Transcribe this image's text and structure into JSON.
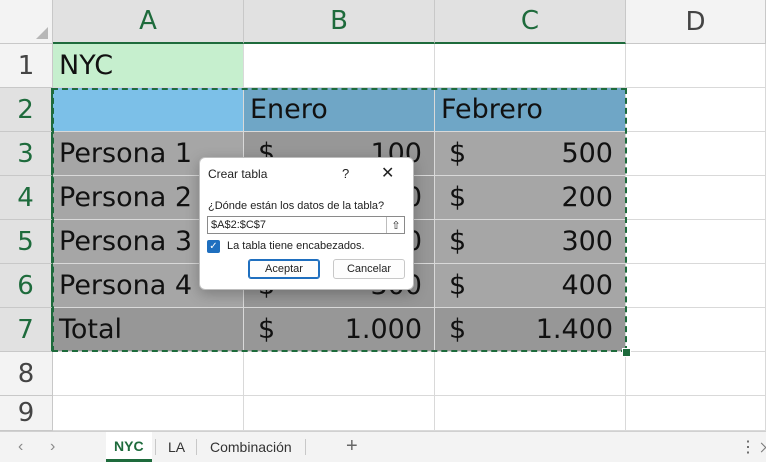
{
  "columns": [
    "A",
    "B",
    "C",
    "D"
  ],
  "rows": [
    "1",
    "2",
    "3",
    "4",
    "5",
    "6",
    "7",
    "8",
    "9"
  ],
  "cells": {
    "a1": "NYC",
    "b2": "Enero",
    "c2": "Febrero",
    "a3": "Persona 1",
    "a4": "Persona 2",
    "a5": "Persona 3",
    "a6": "Persona 4",
    "a7": "Total",
    "currency": "$",
    "b3": "100",
    "b4": "0",
    "b5": "0",
    "b6": "300",
    "b7": "1.000",
    "c3": "500",
    "c4": "200",
    "c5": "300",
    "c6": "400",
    "c7": "1.400"
  },
  "dialog": {
    "title": "Crear tabla",
    "help": "?",
    "close": "✕",
    "question": "¿Dónde están los datos de la tabla?",
    "range_value": "$A$2:$C$7",
    "collapse_icon": "⇧",
    "checkbox_checked": true,
    "checkbox_label": "La tabla tiene encabezados.",
    "ok_label": "Aceptar",
    "cancel_label": "Cancelar"
  },
  "sheet_tabs": {
    "prev": "‹",
    "next": "›",
    "tabs": [
      "NYC",
      "LA",
      "Combinación"
    ],
    "active": "NYC",
    "add": "+",
    "more": "⋮"
  },
  "colors": {
    "accent": "#1e6b3c",
    "header_blue": "#6fa6c6",
    "label_blue": "#7cc0e8",
    "nyc_green": "#c6efce",
    "checkbox_blue": "#1f6fbf"
  }
}
